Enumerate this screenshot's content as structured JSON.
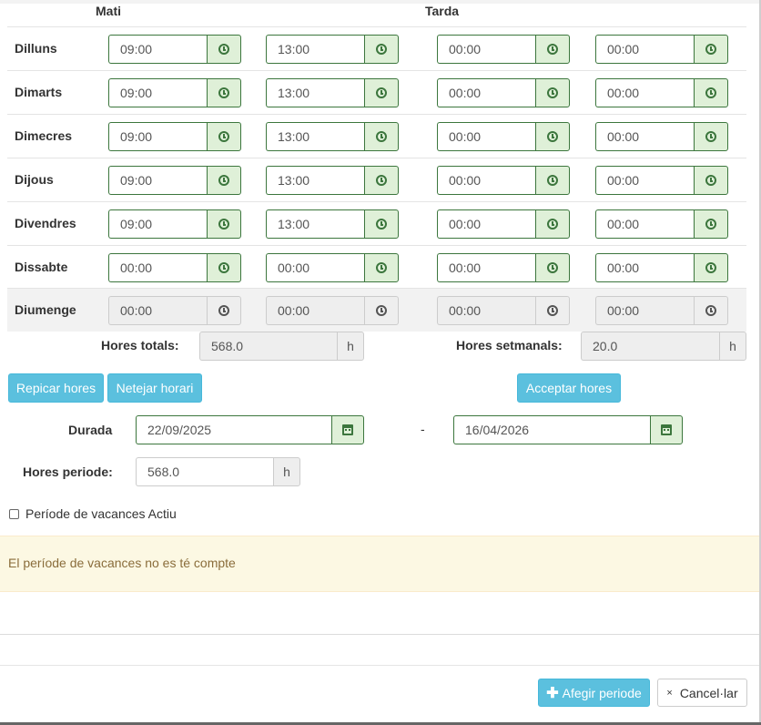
{
  "headers": {
    "mati": "Mati",
    "tarda": "Tarda"
  },
  "days": [
    {
      "label": "Dilluns",
      "times": [
        "09:00",
        "13:00",
        "00:00",
        "00:00"
      ],
      "disabled": false
    },
    {
      "label": "Dimarts",
      "times": [
        "09:00",
        "13:00",
        "00:00",
        "00:00"
      ],
      "disabled": false
    },
    {
      "label": "Dimecres",
      "times": [
        "09:00",
        "13:00",
        "00:00",
        "00:00"
      ],
      "disabled": false
    },
    {
      "label": "Dijous",
      "times": [
        "09:00",
        "13:00",
        "00:00",
        "00:00"
      ],
      "disabled": false
    },
    {
      "label": "Divendres",
      "times": [
        "09:00",
        "13:00",
        "00:00",
        "00:00"
      ],
      "disabled": false
    },
    {
      "label": "Dissabte",
      "times": [
        "00:00",
        "00:00",
        "00:00",
        "00:00"
      ],
      "disabled": false
    },
    {
      "label": "Diumenge",
      "times": [
        "00:00",
        "00:00",
        "00:00",
        "00:00"
      ],
      "disabled": true
    }
  ],
  "totals": {
    "hores_totals_label": "Hores totals:",
    "hores_totals_value": "568.0",
    "hores_setmanals_label": "Hores setmanals:",
    "hores_setmanals_value": "20.0",
    "unit": "h"
  },
  "buttons": {
    "repicar": "Repicar hores",
    "netejar": "Netejar horari",
    "acceptar": "Acceptar hores",
    "afegir": "Afegir periode",
    "cancelar": "Cancel·lar"
  },
  "durada": {
    "label": "Durada",
    "start": "22/09/2025",
    "separator": "-",
    "end": "16/04/2026"
  },
  "hores_periode": {
    "label": "Hores periode:",
    "value": "568.0",
    "unit": "h"
  },
  "vacances": {
    "label": "Període de vacances  Actiu",
    "checked": false
  },
  "alert": {
    "text": "El període de vacances no es té compte"
  },
  "colors": {
    "success_border": "#3c763d",
    "success_bg": "#dff0d8",
    "info_button": "#5bc0de",
    "warning_bg": "#fcf8e3",
    "warning_text": "#8a6d3b"
  }
}
